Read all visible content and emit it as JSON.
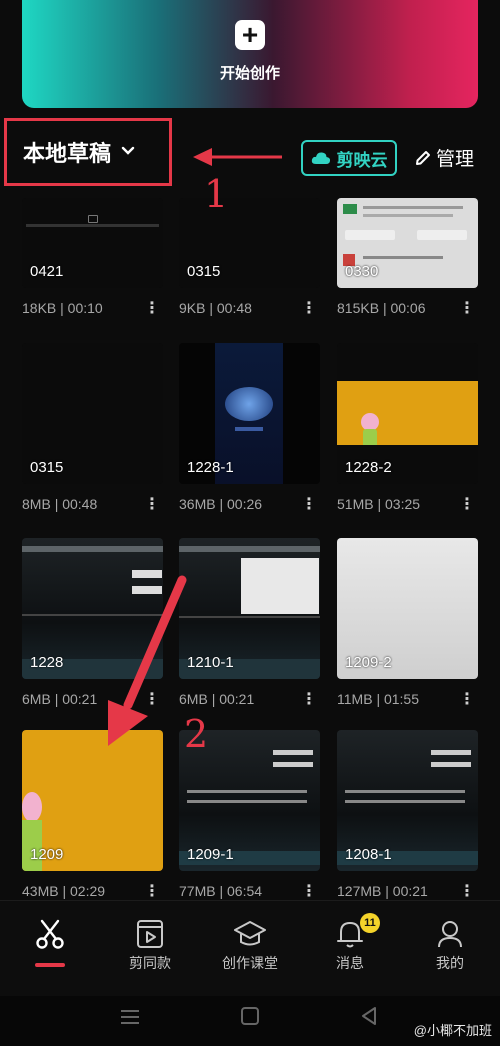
{
  "create": {
    "label": "开始创作",
    "icon": "plus-icon"
  },
  "header": {
    "drafts_title": "本地草稿",
    "cloud_label": "剪映云",
    "manage_label": "管理"
  },
  "annotations": {
    "one": "1",
    "two": "2"
  },
  "drafts": [
    {
      "name": "0421",
      "size": "18KB",
      "duration": "00:10"
    },
    {
      "name": "0315",
      "size": "9KB",
      "duration": "00:48"
    },
    {
      "name": "0330",
      "size": "815KB",
      "duration": "00:06"
    },
    {
      "name": "0315",
      "size": "8MB",
      "duration": "00:48"
    },
    {
      "name": "1228-1",
      "size": "36MB",
      "duration": "00:26"
    },
    {
      "name": "1228-2",
      "size": "51MB",
      "duration": "03:25"
    },
    {
      "name": "1228",
      "size": "6MB",
      "duration": "00:21"
    },
    {
      "name": "1210-1",
      "size": "6MB",
      "duration": "00:21"
    },
    {
      "name": "1209-2",
      "size": "11MB",
      "duration": "01:55"
    },
    {
      "name": "1209",
      "size": "43MB",
      "duration": "02:29"
    },
    {
      "name": "1209-1",
      "size": "77MB",
      "duration": "06:54"
    },
    {
      "name": "1208-1",
      "size": "127MB",
      "duration": "00:21"
    }
  ],
  "meta_separator": "|",
  "tabs": [
    {
      "label": "",
      "icon": "scissors-icon",
      "active": true
    },
    {
      "label": "剪同款",
      "icon": "template-icon"
    },
    {
      "label": "创作课堂",
      "icon": "graduation-cap-icon"
    },
    {
      "label": "消息",
      "icon": "bell-icon",
      "badge": "11"
    },
    {
      "label": "我的",
      "icon": "person-icon"
    }
  ],
  "watermark": "@小椰不加班",
  "colors": {
    "accent": "#e53848",
    "cloud": "#32d3c3",
    "badge": "#f4d32a"
  }
}
